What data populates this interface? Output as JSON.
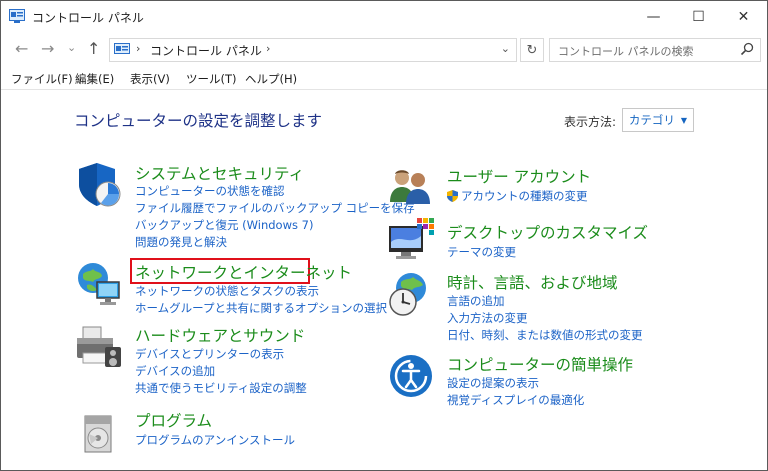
{
  "window": {
    "title": "コントロール パネル",
    "minimize": "—",
    "maximize": "☐",
    "close": "✕"
  },
  "address": {
    "crumb": "コントロール パネル",
    "sep1": "›",
    "sep2": "›",
    "dropdown": "⌄",
    "refresh": "↻",
    "search_placeholder": "コントロール パネルの検索"
  },
  "nav": {
    "back": "←",
    "forward": "→",
    "recent": "⌄",
    "up": "↑"
  },
  "menu": {
    "file": "ファイル(F)",
    "edit": "編集(E)",
    "view": "表示(V)",
    "tools": "ツール(T)",
    "help": "ヘルプ(H)"
  },
  "main": {
    "heading": "コンピューターの設定を調整します",
    "view_label": "表示方法:",
    "view_value": "カテゴリ",
    "view_arrow": "▼"
  },
  "categories": {
    "system": {
      "title": "システムとセキュリティ",
      "links": [
        "コンピューターの状態を確認",
        "ファイル履歴でファイルのバックアップ コピーを保存",
        "バックアップと復元 (Windows 7)",
        "問題の発見と解決"
      ]
    },
    "network": {
      "title": "ネットワークとインターネット",
      "links": [
        "ネットワークの状態とタスクの表示",
        "ホームグループと共有に関するオプションの選択"
      ]
    },
    "hardware": {
      "title": "ハードウェアとサウンド",
      "links": [
        "デバイスとプリンターの表示",
        "デバイスの追加",
        "共通で使うモビリティ設定の調整"
      ]
    },
    "programs": {
      "title": "プログラム",
      "links": [
        "プログラムのアンインストール"
      ]
    },
    "users": {
      "title": "ユーザー アカウント",
      "links": [
        "アカウントの種類の変更"
      ]
    },
    "desktop": {
      "title": "デスクトップのカスタマイズ",
      "links": [
        "テーマの変更"
      ]
    },
    "clock": {
      "title": "時計、言語、および地域",
      "links": [
        "言語の追加",
        "入力方法の変更",
        "日付、時刻、または数値の形式の変更"
      ]
    },
    "access": {
      "title": "コンピューターの簡単操作",
      "links": [
        "設定の提案の表示",
        "視覚ディスプレイの最適化"
      ]
    }
  },
  "colors": {
    "category_title": "#1b8c1b",
    "link": "#1c63c7",
    "heading": "#1e3287",
    "highlight": "#e0101a"
  }
}
